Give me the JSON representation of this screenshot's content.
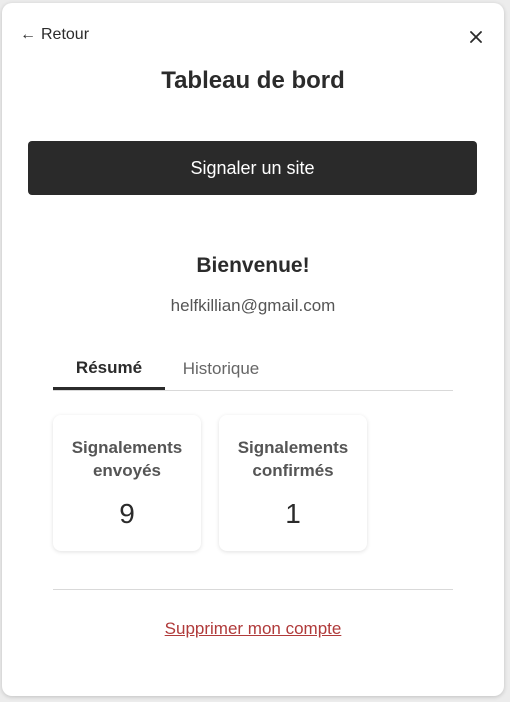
{
  "header": {
    "back_arrow": "←",
    "back_label": "Retour",
    "close_icon": "close-icon"
  },
  "page_title": "Tableau de bord",
  "report_button_label": "Signaler un site",
  "welcome": {
    "heading": "Bienvenue!",
    "email": "helfkillian@gmail.com"
  },
  "tabs": [
    {
      "label": "Résumé",
      "active": true
    },
    {
      "label": "Historique",
      "active": false
    }
  ],
  "stats": [
    {
      "label": "Signalements envoyés",
      "value": "9"
    },
    {
      "label": "Signalements confirmés",
      "value": "1"
    }
  ],
  "delete_account_label": "Supprimer mon compte",
  "colors": {
    "primary_button": "#2a2a2a",
    "danger_link": "#b03a3a",
    "text": "#2b2b2b"
  }
}
